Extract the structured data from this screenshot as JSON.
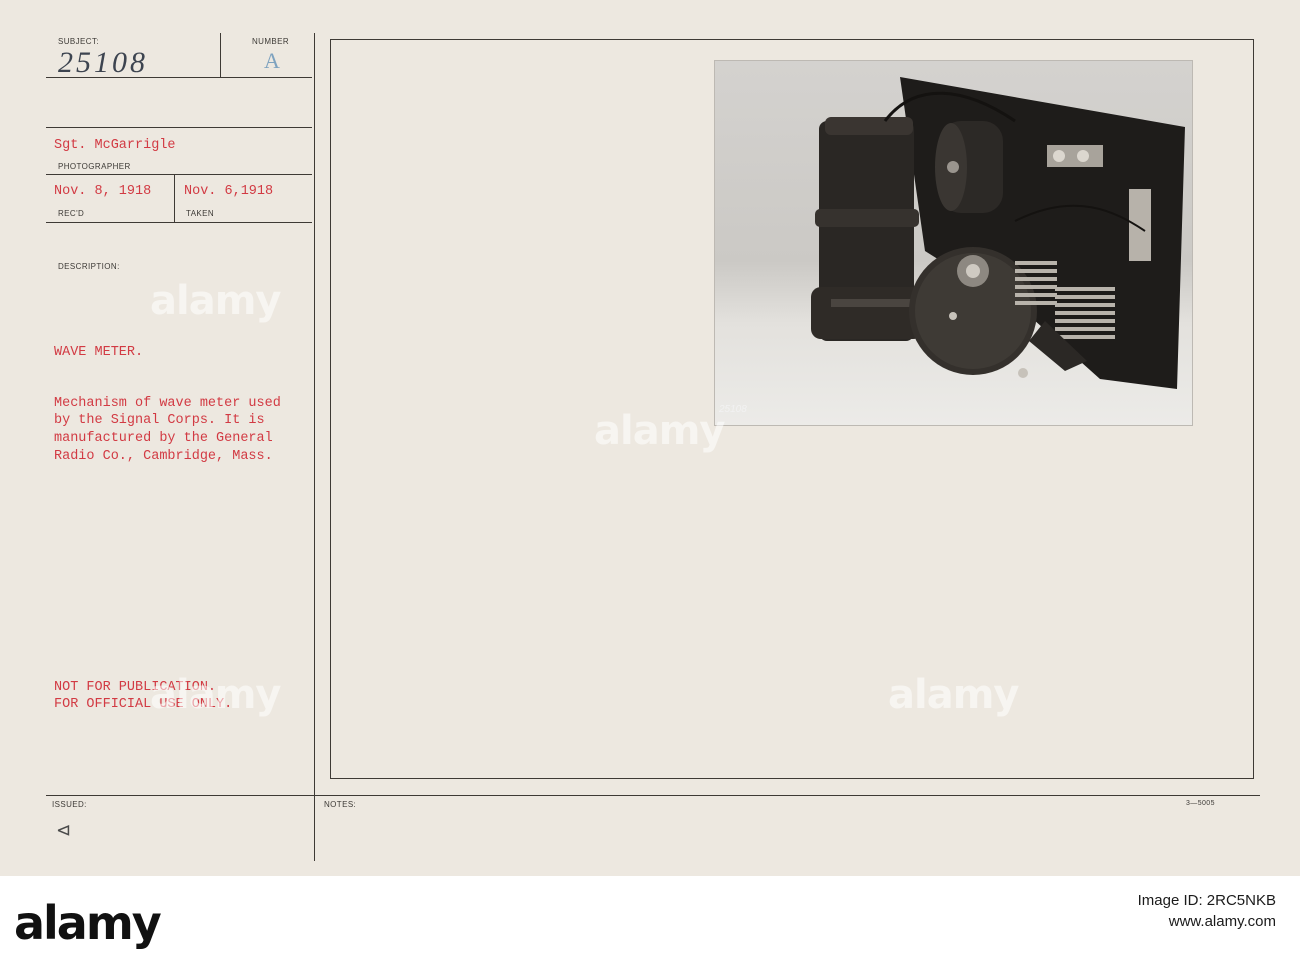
{
  "card": {
    "labels": {
      "subject": "SUBJECT:",
      "number": "NUMBER",
      "photographer": "PHOTOGRAPHER",
      "recd": "REC'D",
      "taken": "TAKEN",
      "description": "DESCRIPTION:",
      "issued": "ISSUED:",
      "notes": "NOTES:"
    },
    "subject_value": "25108",
    "number_value": "A",
    "photographer_name": "Sgt. McGarrigle",
    "recd_date": "Nov. 8, 1918",
    "taken_date": "Nov. 6,1918",
    "title": "WAVE METER.",
    "description_lines": [
      "Mechanism of wave meter used",
      "by the Signal Corps. It is",
      "manufactured by the General",
      "Radio Co., Cambridge, Mass."
    ],
    "restriction_lines": [
      "NOT FOR PUBLICATION.",
      "FOR OFFICIAL USE ONLY."
    ],
    "issued_mark": "⊲",
    "form_code": "3—5005",
    "photo_negative_number": "25108"
  },
  "watermark_text": "alamy",
  "footer": {
    "logo": "alamy",
    "image_id": "Image ID: 2RC5NKB",
    "site": "www.alamy.com"
  },
  "colors": {
    "card_background": "#ede8e0",
    "typewriter_red": "#d23a43",
    "ink_blue": "#3d4450"
  }
}
